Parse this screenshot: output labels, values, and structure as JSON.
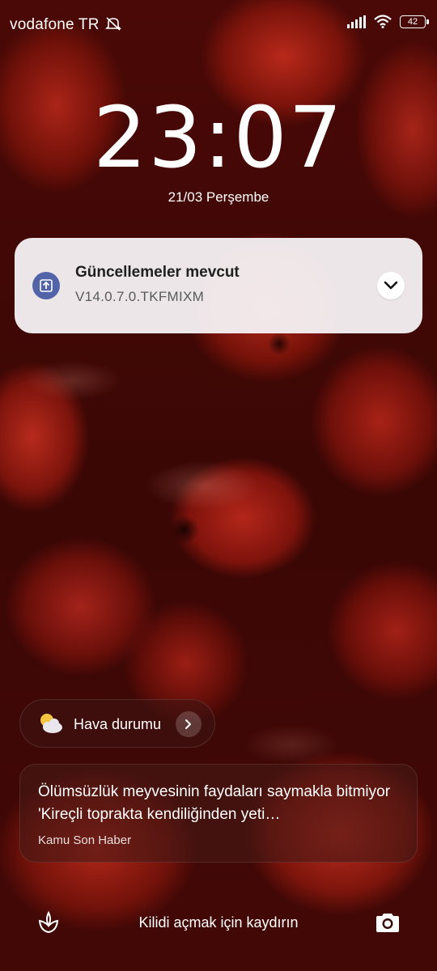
{
  "status_bar": {
    "carrier": "vodafone TR",
    "battery_level": "42",
    "icons": [
      "mute-icon",
      "signal-icon",
      "wifi-icon",
      "battery-icon"
    ]
  },
  "lockscreen": {
    "time": "23:07",
    "date": "21/03 Perşembe"
  },
  "notification": {
    "title": "Güncellemeler mevcut",
    "subtitle": "V14.0.7.0.TKFMIXM",
    "icon": "update-arrow-icon",
    "accent_color": "#5263a8"
  },
  "weather": {
    "label": "Hava durumu",
    "icon": "partly-cloudy-icon"
  },
  "news": {
    "headline": "Ölümsüzlük meyvesinin faydaları saymakla bitmiyor 'Kireçli toprakta kendiliğinden yeti…",
    "source": "Kamu Son Haber"
  },
  "bottom_bar": {
    "unlock_hint": "Kilidi açmak için kaydırın",
    "left_icon": "wallpaper-carousel-icon",
    "right_icon": "camera-icon"
  }
}
